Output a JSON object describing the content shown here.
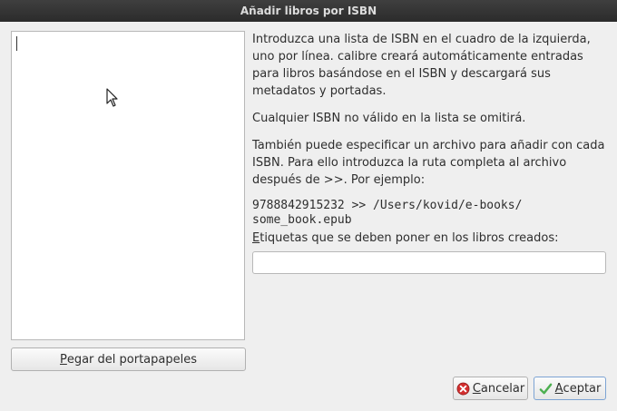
{
  "window": {
    "title": "Añadir libros por ISBN"
  },
  "left_panel": {
    "isbn_list_value": "",
    "paste_button": {
      "mnemonic": "P",
      "rest": "egar del portapapeles"
    }
  },
  "instructions": {
    "paragraph1": "Introduzca una lista de ISBN en el cuadro de la izquierda, uno por línea. calibre creará automáticamente entradas para libros basándose en el ISBN y descargará sus metadatos y portadas.",
    "paragraph2": "Cualquier ISBN no válido en la lista se omitirá.",
    "paragraph3": "También puede especificar un archivo para añadir con cada ISBN. Para ello introduzca la ruta completa al archivo después de >>. Por ejemplo:",
    "example_line1": "9788842915232 >> /Users/kovid/e-books/",
    "example_line2": "some_book.epub"
  },
  "tags": {
    "label_mnemonic": "E",
    "label_rest": "tiquetas que se deben poner en los libros creados:",
    "value": ""
  },
  "buttons": {
    "cancel": {
      "mnemonic": "C",
      "rest": "ancelar",
      "icon": "cancel-icon"
    },
    "accept": {
      "mnemonic": "A",
      "rest": "ceptar",
      "icon": "checkmark-icon"
    }
  },
  "colors": {
    "titlebar": "#2b2b2b",
    "cancel_icon": "#d32f2f",
    "accept_icon": "#4caf50"
  }
}
